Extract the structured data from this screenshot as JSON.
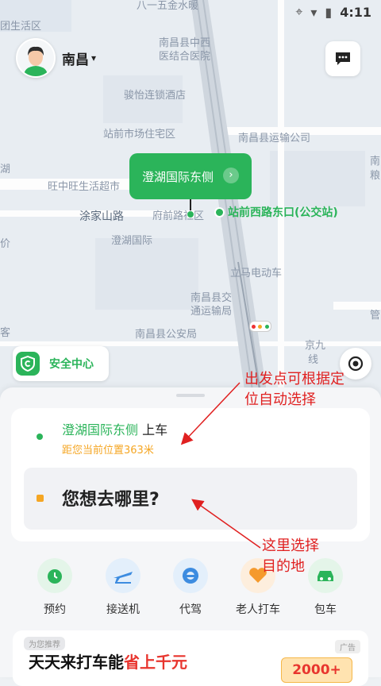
{
  "status_bar": {
    "time": "4:11"
  },
  "header": {
    "city": "南昌"
  },
  "map": {
    "labels": {
      "top_road": "八一五金水暖",
      "life_area": "团生活区",
      "hospital_line1": "南昌县中西",
      "hospital_line2": "医结合医院",
      "hotel": "骏怡连锁酒店",
      "residential": "站前市场住宅区",
      "transport_co": "南昌县运输公司",
      "wangsheng": "旺中旺生活超市",
      "tujia_road": "涂家山路",
      "fuqian": "府前路社区",
      "chenghu_intl": "澄湖国际",
      "liangma": "立马电动车",
      "transport_bureau_1": "南昌县交",
      "transport_bureau_2": "通运输局",
      "police": "南昌县公安局",
      "jingjiu_1": "京九",
      "jingjiu_2": "线",
      "left_fragment": "湖",
      "price_fragment": "价",
      "ke_fragment": "客",
      "right_fragment1": "南",
      "right_fragment2": "粮",
      "right_fragment3": "管"
    },
    "pickup_bubble": "澄湖国际东侧",
    "bus_stop": "站前西路东口(公交站)",
    "safety_center": "安全中心"
  },
  "trip": {
    "origin_place": "澄湖国际东侧",
    "origin_suffix": " 上车",
    "distance": "距您当前位置363米",
    "destination_prompt": "您想去哪里?"
  },
  "services": [
    {
      "label": "预约",
      "icon": "clock-icon"
    },
    {
      "label": "接送机",
      "icon": "airplane-icon"
    },
    {
      "label": "代驾",
      "icon": "steering-wheel-icon"
    },
    {
      "label": "老人打车",
      "icon": "heart-hand-icon"
    },
    {
      "label": "包车",
      "icon": "car-icon"
    }
  ],
  "ad": {
    "tag": "为您推荐",
    "badge": "广告",
    "title_prefix": "天天来打车能",
    "title_highlight": "省上千元",
    "coupon": "2000+"
  },
  "annotations": {
    "note1_line1": "出发点可根据定",
    "note1_line2": "位自动选择",
    "note2_line1": "这里选择",
    "note2_line2": "目的地"
  },
  "colors": {
    "brand_green": "#2bb45a",
    "accent_orange": "#f5a623",
    "annotation_red": "#e02020"
  }
}
